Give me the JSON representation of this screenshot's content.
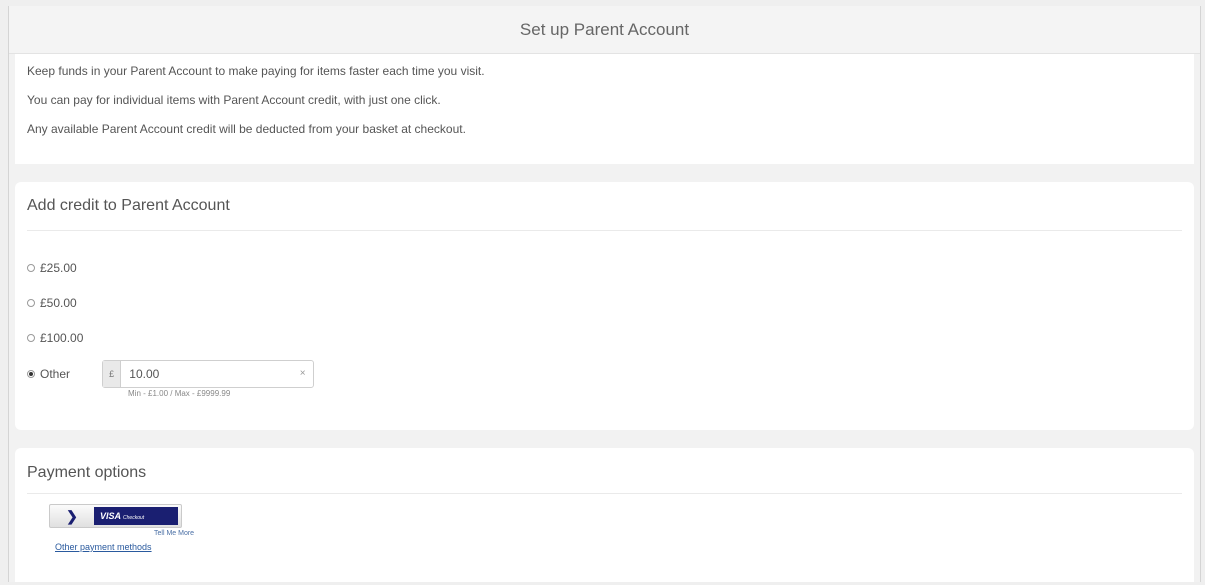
{
  "header": {
    "title": "Set up Parent Account"
  },
  "intro": {
    "lines": [
      "Keep funds in your Parent Account to make paying for items faster each time you visit.",
      "You can pay for individual items with Parent Account credit, with just one click.",
      "Any available Parent Account credit will be deducted from your basket at checkout."
    ]
  },
  "credit": {
    "title": "Add credit to Parent Account",
    "options": [
      {
        "label": "£25.00",
        "selected": false
      },
      {
        "label": "£50.00",
        "selected": false
      },
      {
        "label": "£100.00",
        "selected": false
      }
    ],
    "other": {
      "label": "Other",
      "selected": true,
      "currency": "£",
      "value": "10.00",
      "clear": "×",
      "hint": "Min - £1.00 / Max - £9999.99"
    }
  },
  "payment": {
    "title": "Payment options",
    "visa_label": "VISA",
    "visa_sub": "Checkout",
    "tell_me_more": "Tell Me More",
    "other_methods": "Other payment methods"
  },
  "colors": {
    "visa_blue": "#1a1f71",
    "link_blue": "#2a5a9e"
  }
}
